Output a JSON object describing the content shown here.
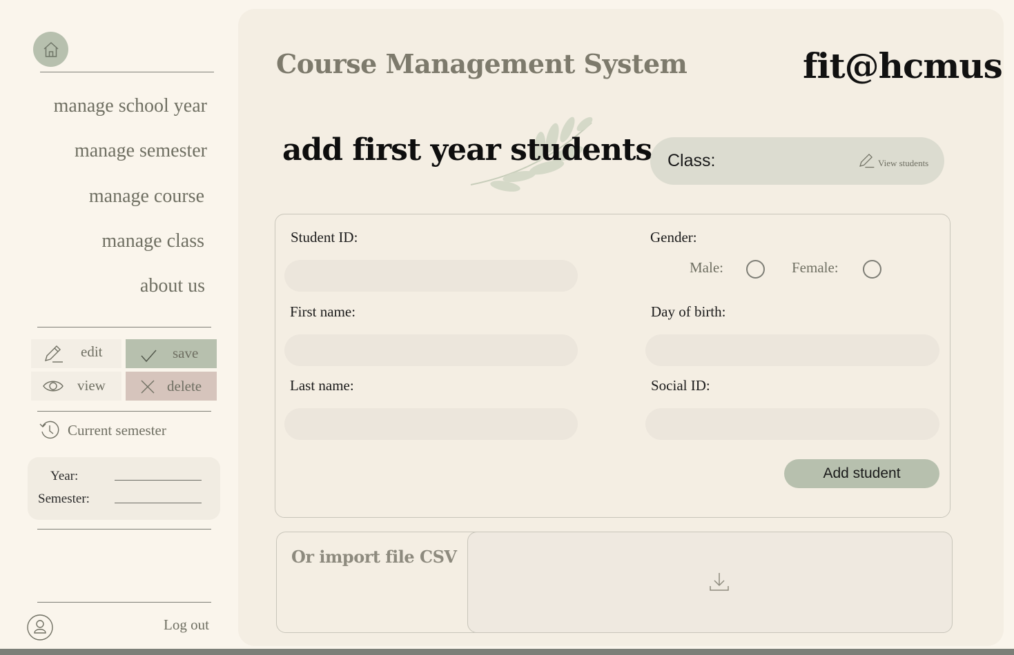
{
  "app": {
    "title": "Course Management System",
    "brand": "fit@hcmus"
  },
  "sidebar": {
    "nav": [
      {
        "label": "manage school year"
      },
      {
        "label": "manage semester"
      },
      {
        "label": "manage course"
      },
      {
        "label": "manage class"
      },
      {
        "label": "about us"
      }
    ],
    "actions": {
      "edit": "edit",
      "save": "save",
      "view": "view",
      "delete": "delete"
    },
    "current_semester": {
      "label": "Current semester",
      "year_label": "Year:",
      "semester_label": "Semester:"
    },
    "logout": "Log out"
  },
  "page": {
    "heading": "add first year students",
    "class": {
      "label": "Class:",
      "view_link": "View students"
    },
    "form": {
      "student_id": {
        "label": "Student ID:",
        "value": ""
      },
      "first_name": {
        "label": "First name:",
        "value": ""
      },
      "last_name": {
        "label": "Last name:",
        "value": ""
      },
      "gender": {
        "label": "Gender:",
        "male": "Male:",
        "female": "Female:"
      },
      "dob": {
        "label": "Day of birth:",
        "value": ""
      },
      "social_id": {
        "label": "Social ID:",
        "value": ""
      },
      "submit": "Add student"
    },
    "import": {
      "label": "Or import file CSV"
    }
  },
  "colors": {
    "background": "#faf5ec",
    "panel": "#f4eee3",
    "sage": "#b7c0ae",
    "rose": "#d6c4bc",
    "muted_text": "#6f6f62"
  },
  "icons": [
    "home-icon",
    "pencil-icon",
    "check-icon",
    "eye-icon",
    "x-icon",
    "history-icon",
    "user-icon",
    "download-icon"
  ]
}
